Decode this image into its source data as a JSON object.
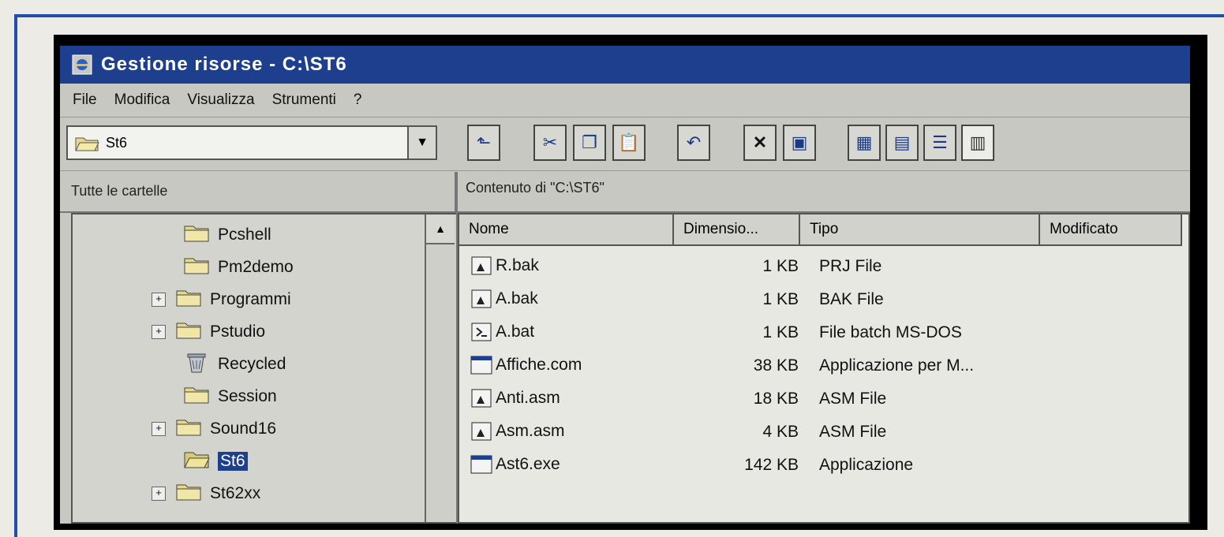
{
  "window": {
    "title": "Gestione risorse - C:\\ST6"
  },
  "menubar": {
    "items": [
      "File",
      "Modifica",
      "Visualizza",
      "Strumenti",
      "?"
    ]
  },
  "address": {
    "value": "St6"
  },
  "panes": {
    "left_header": "Tutte le cartelle",
    "right_header": "Contenuto di \"C:\\ST6\""
  },
  "tree": {
    "items": [
      {
        "label": "Pcshell",
        "expander": "",
        "icon": "folder-icon"
      },
      {
        "label": "Pm2demo",
        "expander": "",
        "icon": "folder-icon"
      },
      {
        "label": "Programmi",
        "expander": "+",
        "icon": "folder-icon"
      },
      {
        "label": "Pstudio",
        "expander": "+",
        "icon": "folder-icon"
      },
      {
        "label": "Recycled",
        "expander": "",
        "icon": "recycle-bin-icon"
      },
      {
        "label": "Session",
        "expander": "",
        "icon": "folder-icon"
      },
      {
        "label": "Sound16",
        "expander": "+",
        "icon": "folder-icon"
      },
      {
        "label": "St6",
        "expander": "",
        "icon": "open-folder-icon",
        "selected": true
      },
      {
        "label": "St62xx",
        "expander": "+",
        "icon": "folder-icon"
      }
    ]
  },
  "list": {
    "columns": [
      "Nome",
      "Dimensio...",
      "Tipo",
      "Modificato"
    ],
    "rows": [
      {
        "name": "R.bak",
        "size": "1 KB",
        "type": "PRJ File",
        "icon": "document-icon"
      },
      {
        "name": "A.bak",
        "size": "1 KB",
        "type": "BAK File",
        "icon": "document-icon"
      },
      {
        "name": "A.bat",
        "size": "1 KB",
        "type": "File batch MS-DOS",
        "icon": "batch-file-icon"
      },
      {
        "name": "Affiche.com",
        "size": "38 KB",
        "type": "Applicazione per M...",
        "icon": "application-icon"
      },
      {
        "name": "Anti.asm",
        "size": "18 KB",
        "type": "ASM File",
        "icon": "document-icon"
      },
      {
        "name": "Asm.asm",
        "size": "4 KB",
        "type": "ASM File",
        "icon": "document-icon"
      },
      {
        "name": "Ast6.exe",
        "size": "142 KB",
        "type": "Applicazione",
        "icon": "application-icon"
      }
    ]
  },
  "toolbar_icons": [
    "up-folder-icon",
    "cut-icon",
    "copy-icon",
    "paste-icon",
    "undo-icon",
    "delete-icon",
    "properties-icon",
    "large-icons-icon",
    "small-icons-icon",
    "list-view-icon",
    "details-view-icon"
  ],
  "colors": {
    "titlebar": "#1d3f8e",
    "selection": "#1d3f8e"
  }
}
